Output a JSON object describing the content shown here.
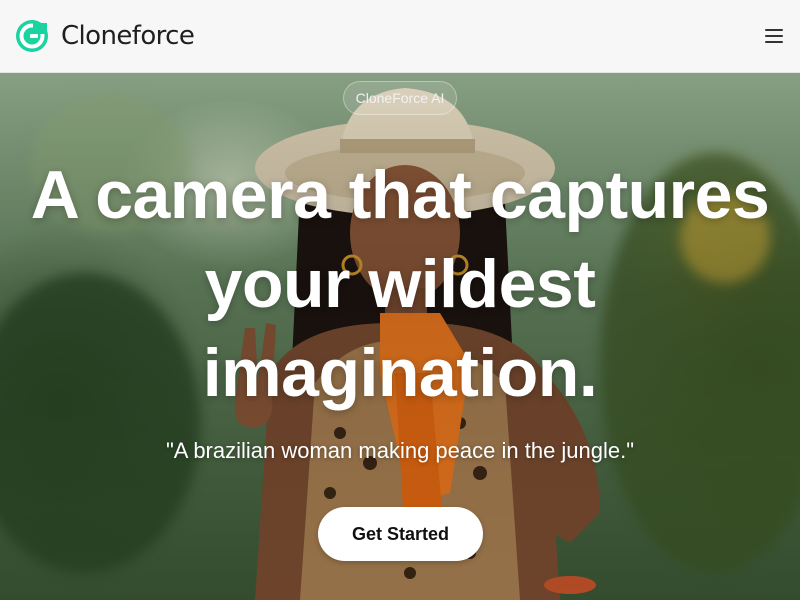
{
  "header": {
    "brand_name": "Cloneforce",
    "logo_icon": "cloneforce-logo-icon",
    "menu_icon": "hamburger-menu-icon"
  },
  "hero": {
    "badge": "CloneForce AI",
    "headline": "A camera that captures your wildest imagination.",
    "caption": "\"A brazilian woman making peace in the jungle.\"",
    "cta_label": "Get Started",
    "background_image": "woman-in-jungle-image"
  },
  "colors": {
    "accent": "#19d3a0",
    "nav_background": "#f7f7f7",
    "button_background": "#ffffff",
    "headline_text": "#ffffff"
  }
}
